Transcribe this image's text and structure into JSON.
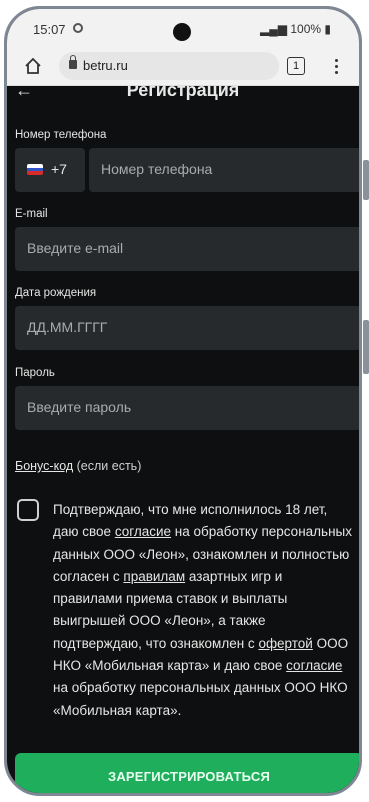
{
  "status_bar": {
    "time": "15:07",
    "battery": "100%"
  },
  "browser": {
    "url": "betru.ru",
    "tab_count": "1"
  },
  "page": {
    "title": "Регистрация"
  },
  "form": {
    "phone_label": "Номер телефона",
    "country_code": "+7",
    "phone_placeholder": "Номер телефона",
    "email_label": "E-mail",
    "email_placeholder": "Введите e-mail",
    "dob_label": "Дата рождения",
    "dob_placeholder": "ДД.ММ.ГГГГ",
    "password_label": "Пароль",
    "password_placeholder": "Введите пароль",
    "bonus_link": "Бонус-код",
    "bonus_suffix": " (если есть)"
  },
  "consent": {
    "t1": "Подтверждаю, что мне исполнилось 18 лет, даю свое ",
    "link1": "согласие",
    "t2": " на обработку персональных данных ООО «Леон», ознакомлен и полностью согласен с ",
    "link2": "правилам",
    "t3": " азартных игр и правилами приема ставок и выплаты выигрышей ООО «Леон», а также подтверждаю, что ознакомлен с ",
    "link3": "офертой",
    "t4": " ООО НКО «Мобильная карта» и даю свое ",
    "link4": "согласие",
    "t5": " на обработку персональных данных ООО НКО «Мобильная карта»."
  },
  "register_button": "ЗАРЕГИСТРИРОВАТЬСЯ",
  "colors": {
    "accent": "#1fae5b",
    "background": "#0e0f10",
    "field": "#262a2c"
  }
}
